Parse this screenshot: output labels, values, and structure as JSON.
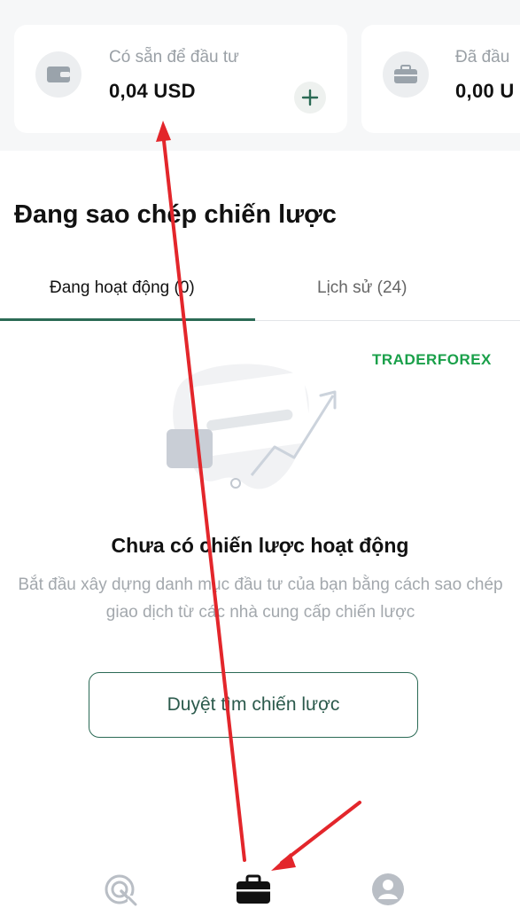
{
  "balance_cards": [
    {
      "label": "Có sẵn để đầu tư",
      "value": "0,04 USD",
      "icon": "wallet-icon",
      "action_icon": "plus-icon"
    },
    {
      "label": "Đã đầu",
      "value": "0,00 U",
      "icon": "briefcase-icon"
    }
  ],
  "section": {
    "title": "Đang sao chép chiến lược"
  },
  "tabs": [
    {
      "label": "Đang hoạt động (0)",
      "active": true
    },
    {
      "label": "Lịch sử (24)",
      "active": false
    }
  ],
  "watermark": {
    "text": "TRADERFOREX"
  },
  "empty_state": {
    "title": "Chưa có chiến lược hoạt động",
    "description": "Bắt đầu xây dựng danh mục đầu tư của bạn bằng cách sao chép giao dịch từ các nhà cung cấp chiến lược",
    "button_label": "Duyệt tìm chiến lược"
  },
  "bottom_nav": [
    {
      "icon": "strategy-target-icon"
    },
    {
      "icon": "briefcase-icon",
      "active": true
    },
    {
      "icon": "profile-icon"
    }
  ],
  "colors": {
    "accent": "#2b6a55",
    "annotation_arrow": "#e3262b",
    "muted_text": "#a3a8ad",
    "watermark": "#1aa04a"
  }
}
